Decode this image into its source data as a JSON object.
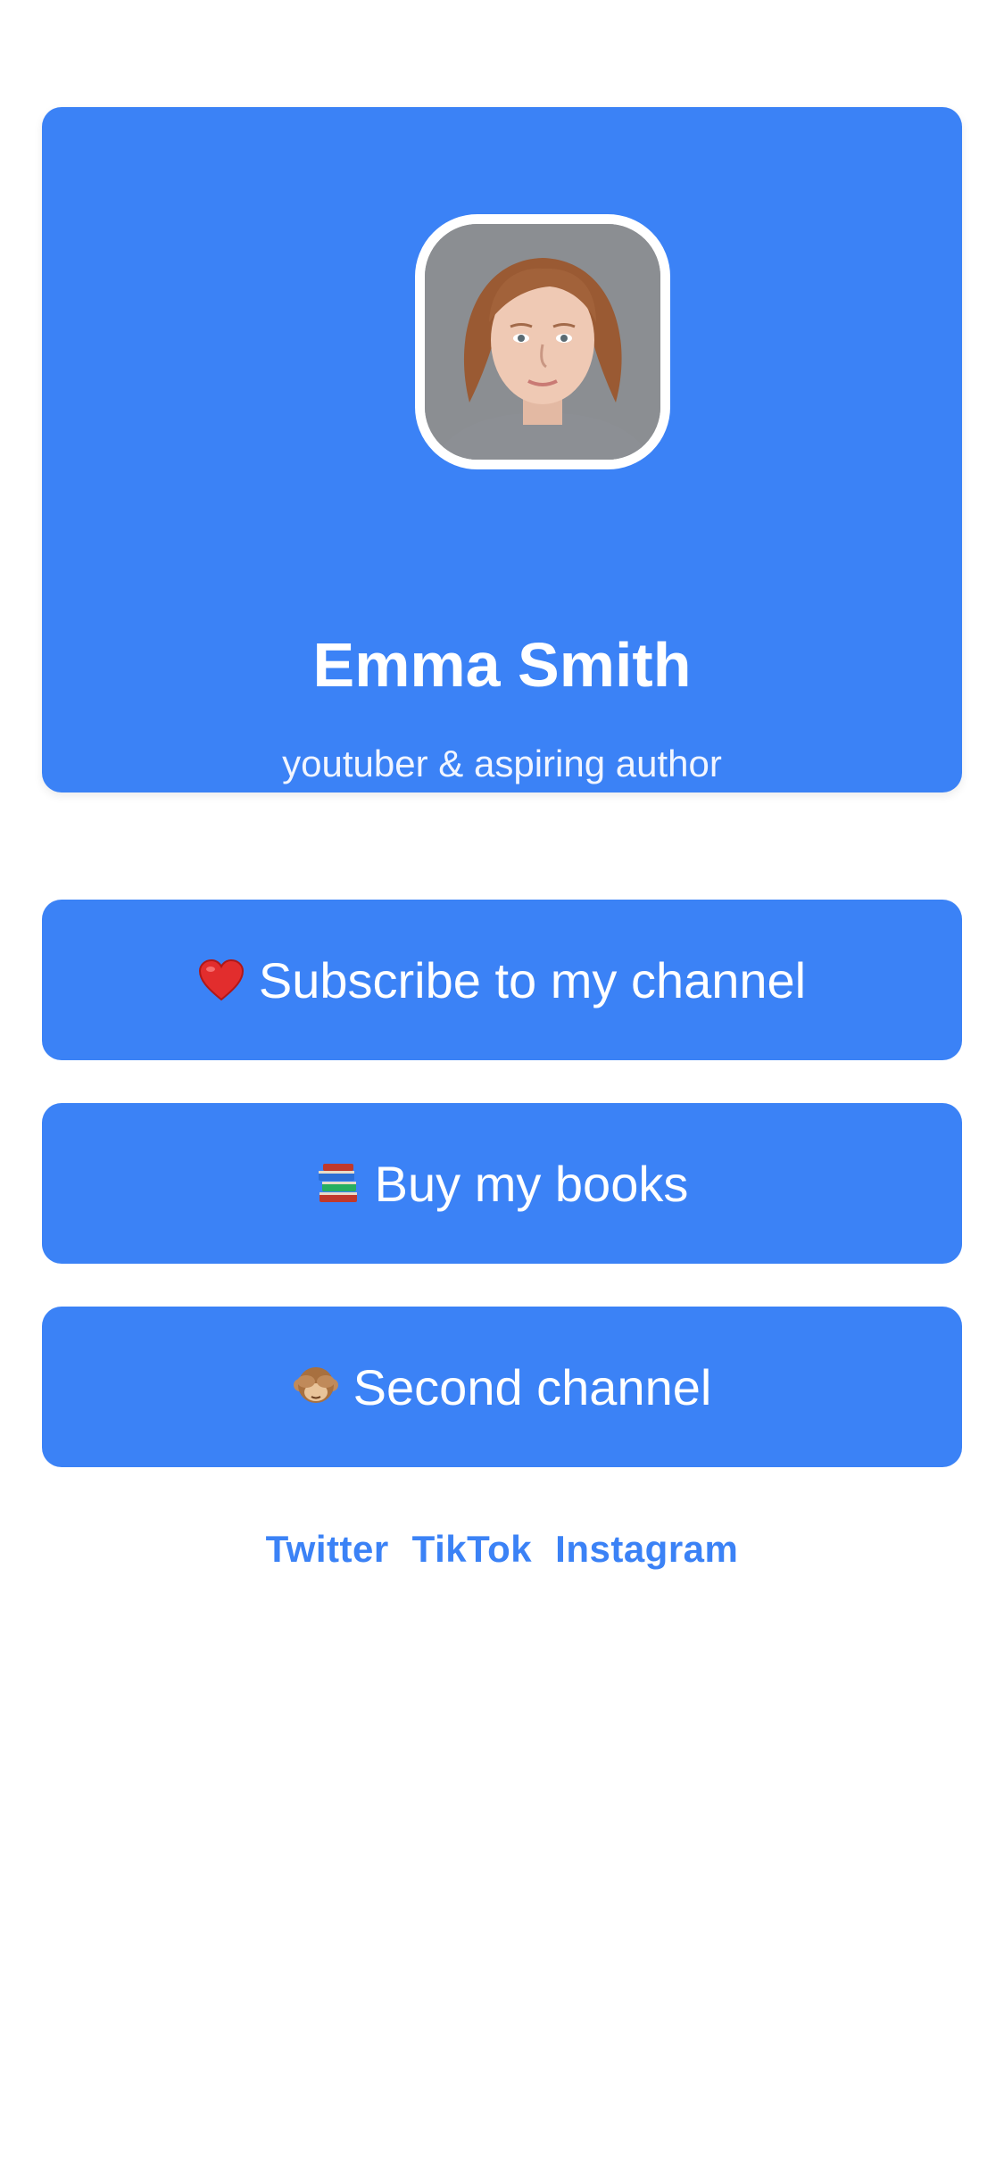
{
  "profile": {
    "name": "Emma Smith",
    "tagline": "youtuber & aspiring author"
  },
  "links": [
    {
      "icon": "red-heart-icon",
      "label": "Subscribe to my channel"
    },
    {
      "icon": "books-icon",
      "label": "Buy my books"
    },
    {
      "icon": "see-no-evil-monkey-icon",
      "label": "Second channel"
    }
  ],
  "socials": [
    "Twitter",
    "TikTok",
    "Instagram"
  ],
  "colors": {
    "accent": "#3b82f6",
    "background": "#ffffff",
    "text_on_accent": "#ffffff"
  }
}
